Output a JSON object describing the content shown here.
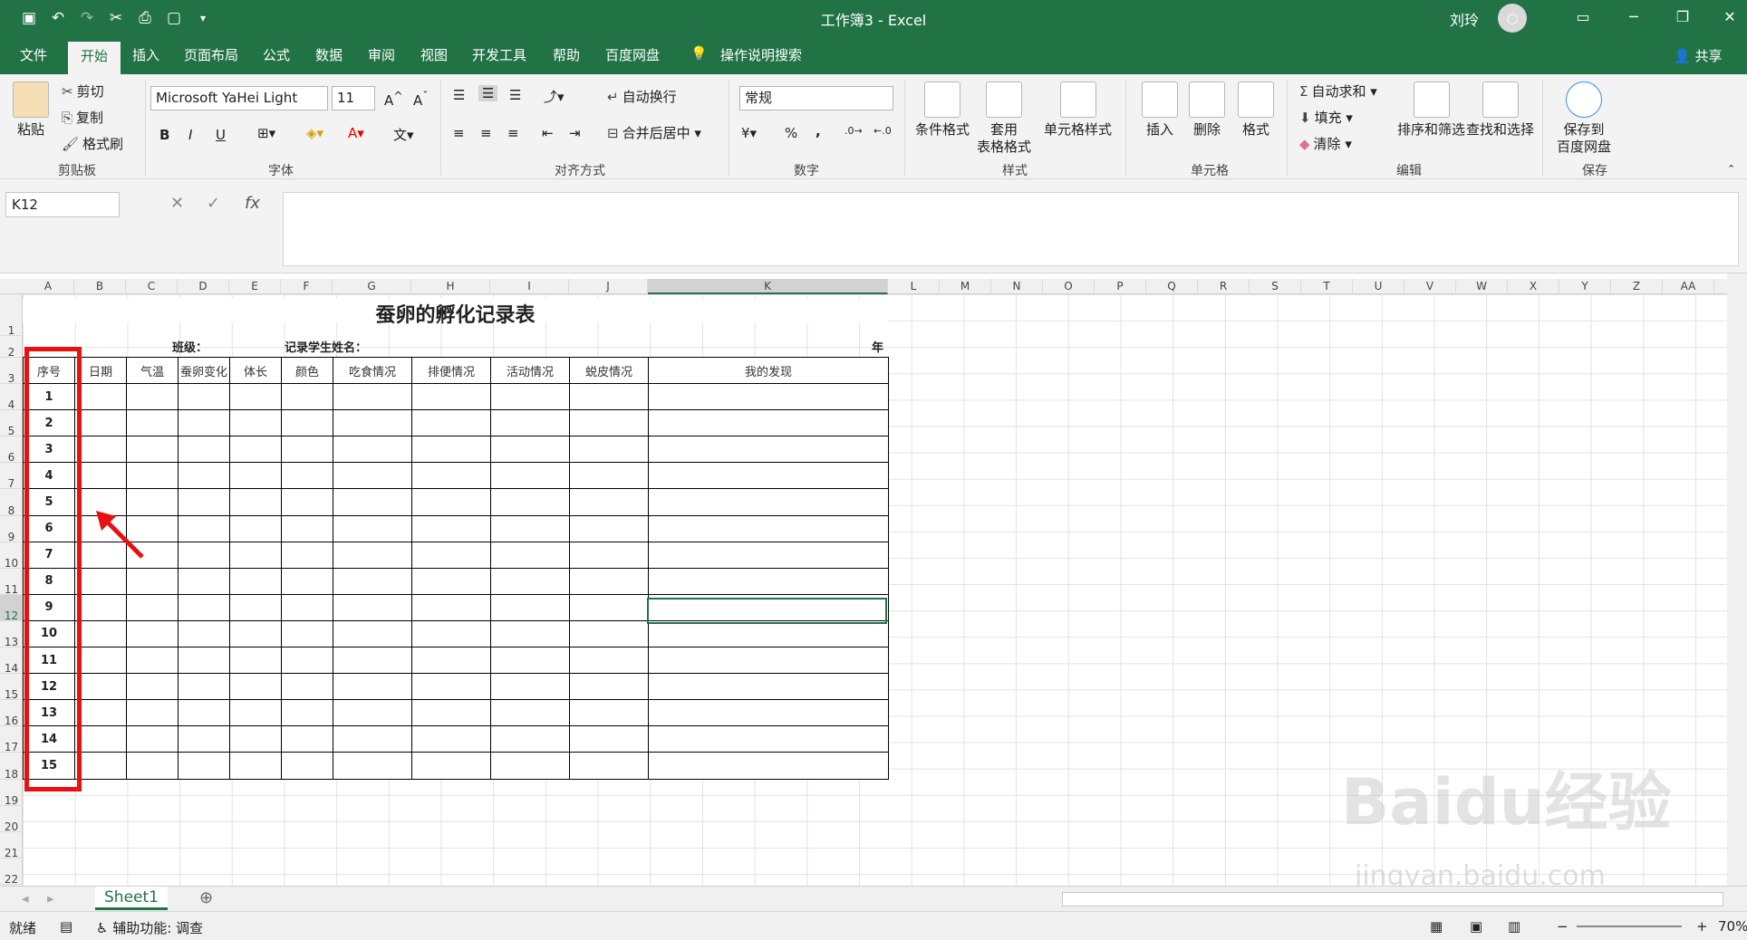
{
  "window": {
    "title": "工作簿3  -  Excel",
    "user": "刘玲",
    "avatar_glyph": "○"
  },
  "tabs": [
    "文件",
    "开始",
    "插入",
    "页面布局",
    "公式",
    "数据",
    "审阅",
    "视图",
    "开发工具",
    "帮助",
    "百度网盘"
  ],
  "tell_me": "操作说明搜索",
  "share": "共享",
  "ribbon": {
    "clipboard": {
      "paste": "粘贴",
      "cut": "剪切",
      "copy": "复制",
      "format_painter": "格式刷",
      "group": "剪贴板"
    },
    "font": {
      "name": "Microsoft YaHei Light",
      "size": "11",
      "group": "字体",
      "bold": "B",
      "italic": "I",
      "underline": "U"
    },
    "alignment": {
      "wrap": "自动换行",
      "merge": "合并后居中",
      "group": "对齐方式"
    },
    "number": {
      "format": "常规",
      "group": "数字",
      "percent": "%",
      "comma": ","
    },
    "styles": {
      "conditional": "条件格式",
      "table_line1": "套用",
      "table_line2": "表格格式",
      "cell_styles": "单元格样式",
      "group": "样式"
    },
    "cells": {
      "insert": "插入",
      "delete": "删除",
      "format": "格式",
      "group": "单元格"
    },
    "editing": {
      "autosum": "自动求和",
      "fill": "填充",
      "clear": "清除",
      "sort": "排序和筛选",
      "find": "查找和选择",
      "group": "编辑"
    },
    "save": {
      "line1": "保存到",
      "line2": "百度网盘",
      "group": "保存"
    }
  },
  "formula_bar": {
    "name_box": "K12",
    "fx": "fx"
  },
  "columns": [
    "A",
    "B",
    "C",
    "D",
    "E",
    "F",
    "G",
    "H",
    "I",
    "J",
    "K",
    "L",
    "M",
    "N",
    "O",
    "P",
    "Q",
    "R",
    "S",
    "T",
    "U",
    "V",
    "W",
    "X",
    "Y",
    "Z",
    "AA"
  ],
  "rows": [
    "1",
    "2",
    "3",
    "4",
    "5",
    "6",
    "7",
    "8",
    "9",
    "10",
    "11",
    "12",
    "13",
    "14",
    "15",
    "16",
    "17",
    "18",
    "19",
    "20",
    "21",
    "22"
  ],
  "sheet": {
    "title": "蚕卵的孵化记录表",
    "class_label": "班级：",
    "student_label": "记录学生姓名：",
    "year_label": "年",
    "headers": [
      "序号",
      "日期",
      "气温",
      "蚕卵变化",
      "体长",
      "颜色",
      "吃食情况",
      "排便情况",
      "活动情况",
      "蜕皮情况",
      "我的发现"
    ],
    "numbers": [
      "1",
      "2",
      "3",
      "4",
      "5",
      "6",
      "7",
      "8",
      "9",
      "10",
      "11",
      "12",
      "13",
      "14",
      "15"
    ]
  },
  "sheet_tab": "Sheet1",
  "status": {
    "ready": "就绪",
    "accessibility": "辅助功能: 调查",
    "zoom": "70%"
  },
  "watermark": {
    "main": "Baidu经验",
    "sub": "jingyan.baidu.com"
  },
  "colors": {
    "excel_green": "#217346",
    "highlight_red": "#e81010"
  }
}
